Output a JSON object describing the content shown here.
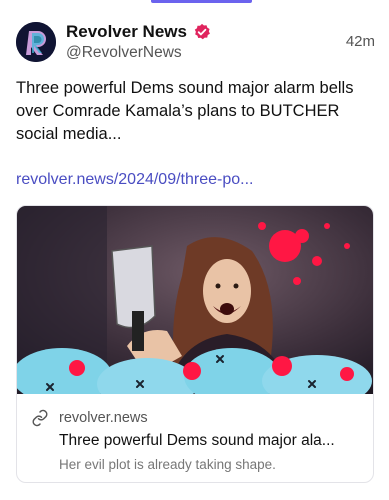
{
  "post": {
    "display_name": "Revolver News",
    "handle": "@RevolverNews",
    "timestamp": "42m",
    "text": "Three powerful Dems sound major alarm bells over Comrade Kamala’s plans to BUTCHER social media...",
    "link": "revolver.news/2024/09/three-po..."
  },
  "card": {
    "domain": "revolver.news",
    "title": "Three powerful Dems sound major ala...",
    "description": "Her evil plot is already taking shape."
  },
  "icons": {
    "avatar": "revolver-logo-icon",
    "verified": "verified-badge-icon",
    "link": "link-icon"
  },
  "colors": {
    "accent": "#6b63ee",
    "link": "#4a4dc2",
    "verified": "#e0245e"
  }
}
